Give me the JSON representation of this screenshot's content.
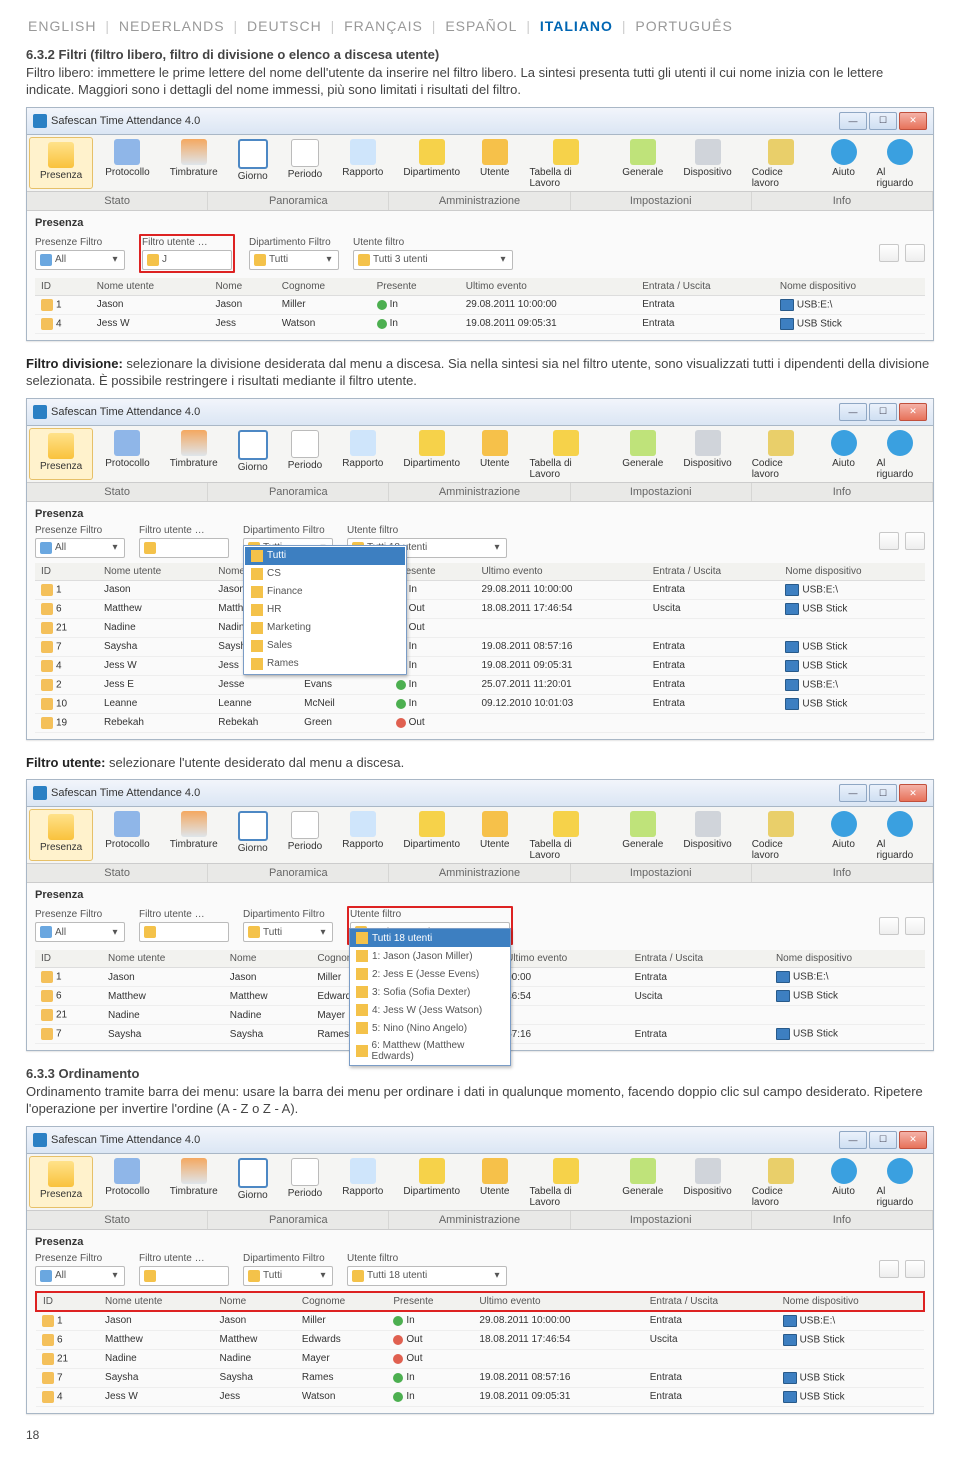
{
  "lang": {
    "items": [
      "ENGLISH",
      "NEDERLANDS",
      "DEUTSCH",
      "FRANÇAIS",
      "ESPAÑOL",
      "ITALIANO",
      "PORTUGUÊS"
    ],
    "active": "ITALIANO"
  },
  "sec1": {
    "title": "6.3.2 Filtri (filtro libero, filtro di divisione o elenco a discesa utente)",
    "p": "Filtro libero: immettere le prime lettere del nome dell'utente da inserire nel filtro libero. La sintesi presenta tutti gli utenti il cui nome inizia con le lettere indicate. Maggiori sono i dettagli del nome immessi, più sono limitati i risultati del filtro."
  },
  "app_title": "Safescan Time Attendance 4.0",
  "toolbar": [
    {
      "label": "Presenza",
      "cls": "ico-presenza",
      "active": true
    },
    {
      "label": "Protocollo",
      "cls": "ico-protocol"
    },
    {
      "label": "Timbrature",
      "cls": "ico-timb"
    },
    {
      "label": "Giorno",
      "cls": "ico-giorno"
    },
    {
      "label": "Periodo",
      "cls": "ico-periodo"
    },
    {
      "label": "Rapporto",
      "cls": "ico-rapporto"
    },
    {
      "label": "Dipartimento",
      "cls": "ico-dip"
    },
    {
      "label": "Utente",
      "cls": "ico-utente"
    },
    {
      "label": "Tabella di Lavoro",
      "cls": "ico-tabella"
    },
    {
      "label": "Generale",
      "cls": "ico-gen"
    },
    {
      "label": "Dispositivo",
      "cls": "ico-disp"
    },
    {
      "label": "Codice lavoro",
      "cls": "ico-cod"
    },
    {
      "label": "Aiuto",
      "cls": "ico-help"
    },
    {
      "label": "Al riguardo",
      "cls": "ico-info"
    }
  ],
  "tabs": [
    "Stato",
    "Panoramica",
    "Amministrazione",
    "Impostazioni",
    "Info"
  ],
  "sub": "Presenza",
  "filter_labels": {
    "pf": "Presenze Filtro",
    "uf": "Filtro utente …",
    "df": "Dipartimento Filtro",
    "utf": "Utente filtro"
  },
  "combo": {
    "all": "All",
    "tutti": "Tutti",
    "u3": "Tutti 3 utenti",
    "u18": "Tutti 18 utenti",
    "j": "J"
  },
  "cols": [
    "ID",
    "Nome utente",
    "Nome",
    "Cognome",
    "Presente",
    "Ultimo evento",
    "Entrata / Uscita",
    "Nome dispositivo"
  ],
  "rows1": [
    {
      "id": "1",
      "un": "Jason",
      "n": "Jason",
      "c": "Miller",
      "p": "In",
      "ev": "29.08.2011 10:00:00",
      "io": "Entrata",
      "d": "USB:E:\\"
    },
    {
      "id": "4",
      "un": "Jess W",
      "n": "Jess",
      "c": "Watson",
      "p": "In",
      "ev": "19.08.2011 09:05:31",
      "io": "Entrata",
      "d": "USB Stick"
    }
  ],
  "sec2": {
    "p": "Filtro divisione: selezionare la divisione desiderata dal menu a discesa. Sia nella sintesi sia nel filtro utente, sono visualizzati tutti i dipendenti della divisione selezionata. È possibile restringere i risultati mediante il filtro utente."
  },
  "dept_dd": [
    "Tutti",
    "CS",
    "Finance",
    "HR",
    "Marketing",
    "Sales",
    "Rames"
  ],
  "rows2": [
    {
      "id": "1",
      "un": "Jason",
      "n": "Jason",
      "c": "Miller",
      "p": "In",
      "ev": "29.08.2011 10:00:00",
      "io": "Entrata",
      "d": "USB:E:\\"
    },
    {
      "id": "6",
      "un": "Matthew",
      "n": "Matthew",
      "c": "Edwards",
      "p": "Out",
      "ev": "18.08.2011 17:46:54",
      "io": "Uscita",
      "d": "USB Stick"
    },
    {
      "id": "21",
      "un": "Nadine",
      "n": "Nadine",
      "c": "Mayer",
      "p": "Out",
      "ev": "",
      "io": "",
      "d": ""
    },
    {
      "id": "7",
      "un": "Saysha",
      "n": "Saysha",
      "c": "Rames",
      "p": "In",
      "ev": "19.08.2011 08:57:16",
      "io": "Entrata",
      "d": "USB Stick"
    },
    {
      "id": "4",
      "un": "Jess W",
      "n": "Jess",
      "c": "Watson",
      "p": "In",
      "ev": "19.08.2011 09:05:31",
      "io": "Entrata",
      "d": "USB Stick"
    },
    {
      "id": "2",
      "un": "Jess E",
      "n": "Jesse",
      "c": "Evans",
      "p": "In",
      "ev": "25.07.2011 11:20:01",
      "io": "Entrata",
      "d": "USB:E:\\"
    },
    {
      "id": "10",
      "un": "Leanne",
      "n": "Leanne",
      "c": "McNeil",
      "p": "In",
      "ev": "09.12.2010 10:01:03",
      "io": "Entrata",
      "d": "USB Stick"
    },
    {
      "id": "19",
      "un": "Rebekah",
      "n": "Rebekah",
      "c": "Green",
      "p": "Out",
      "ev": "",
      "io": "",
      "d": ""
    }
  ],
  "sec3": {
    "p": "Filtro utente: selezionare l'utente desiderato dal menu a discesa."
  },
  "user_dd": [
    "Tutti 18 utenti",
    "1: Jason (Jason Miller)",
    "2: Jess E (Jesse Evens)",
    "3: Sofia (Sofia Dexter)",
    "4: Jess W (Jess Watson)",
    "5: Nino (Nino Angelo)",
    "6: Matthew (Matthew Edwards)"
  ],
  "rows3": [
    {
      "id": "1",
      "un": "Jason",
      "n": "Jason",
      "c": "Miller",
      "ev": "00:00",
      "io": "Entrata",
      "d": "USB:E:\\"
    },
    {
      "id": "6",
      "un": "Matthew",
      "n": "Matthew",
      "c": "Edwards",
      "ev": "46:54",
      "io": "Uscita",
      "d": "USB Stick"
    },
    {
      "id": "21",
      "un": "Nadine",
      "n": "Nadine",
      "c": "Mayer",
      "ev": "",
      "io": "",
      "d": ""
    },
    {
      "id": "7",
      "un": "Saysha",
      "n": "Saysha",
      "c": "Rames",
      "ev": "57:16",
      "io": "Entrata",
      "d": "USB Stick"
    }
  ],
  "sec4": {
    "title": "6.3.3 Ordinamento",
    "p": "Ordinamento tramite barra dei menu: usare la barra dei menu per ordinare i dati in qualunque momento, facendo doppio clic sul campo desiderato. Ripetere l'operazione per invertire l'ordine (A - Z o Z - A)."
  },
  "rows4": [
    {
      "id": "1",
      "un": "Jason",
      "n": "Jason",
      "c": "Miller",
      "p": "In",
      "ev": "29.08.2011 10:00:00",
      "io": "Entrata",
      "d": "USB:E:\\"
    },
    {
      "id": "6",
      "un": "Matthew",
      "n": "Matthew",
      "c": "Edwards",
      "p": "Out",
      "ev": "18.08.2011 17:46:54",
      "io": "Uscita",
      "d": "USB Stick"
    },
    {
      "id": "21",
      "un": "Nadine",
      "n": "Nadine",
      "c": "Mayer",
      "p": "Out",
      "ev": "",
      "io": "",
      "d": ""
    },
    {
      "id": "7",
      "un": "Saysha",
      "n": "Saysha",
      "c": "Rames",
      "p": "In",
      "ev": "19.08.2011 08:57:16",
      "io": "Entrata",
      "d": "USB Stick"
    },
    {
      "id": "4",
      "un": "Jess W",
      "n": "Jess",
      "c": "Watson",
      "p": "In",
      "ev": "19.08.2011 09:05:31",
      "io": "Entrata",
      "d": "USB Stick"
    }
  ],
  "page": "18"
}
